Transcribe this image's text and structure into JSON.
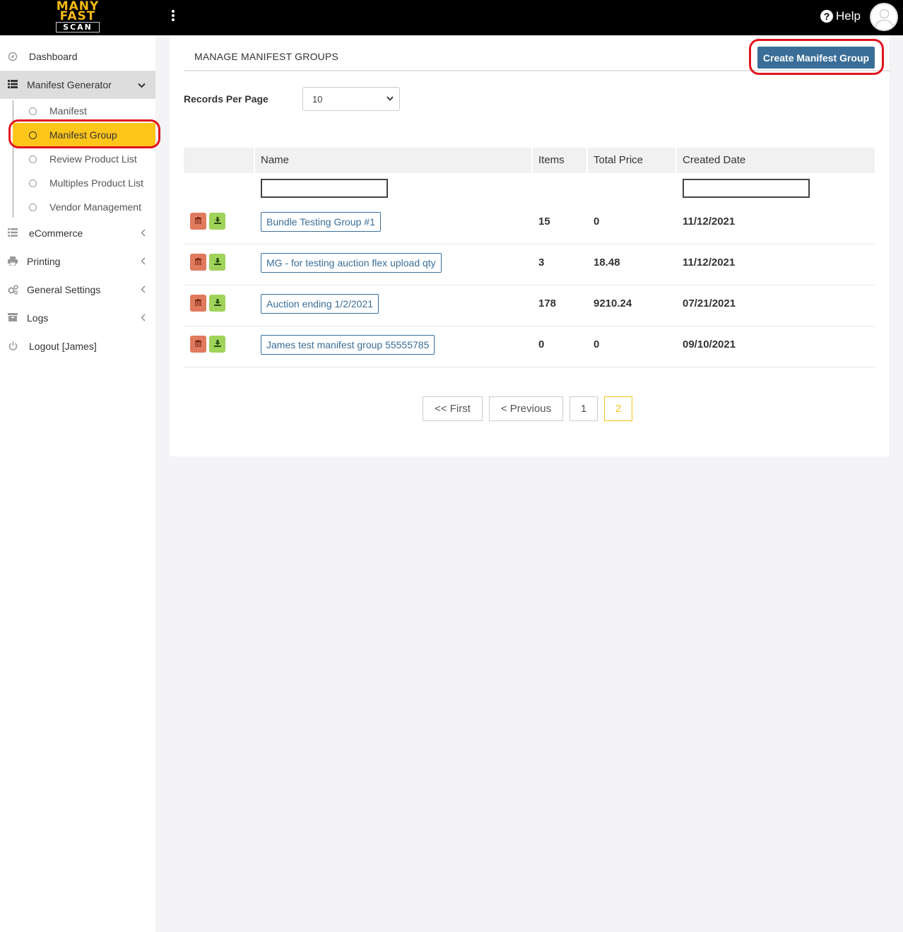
{
  "app": {
    "logo_line1": "MANY",
    "logo_line2": "FAST",
    "logo_line3": "SCAN"
  },
  "topbar": {
    "help_label": "Help",
    "help_icon": "question-circle-icon"
  },
  "sidebar": {
    "items": [
      {
        "label": "Dashboard",
        "icon": "compass-icon"
      },
      {
        "label": "Manifest Generator",
        "icon": "list-icon",
        "expanded": true
      },
      {
        "label": "eCommerce",
        "icon": "list-icon"
      },
      {
        "label": "Printing",
        "icon": "printer-icon"
      },
      {
        "label": "General Settings",
        "icon": "gears-icon"
      },
      {
        "label": "Logs",
        "icon": "archive-icon"
      },
      {
        "label": "Logout [James]",
        "icon": "power-icon"
      }
    ],
    "sub_items": [
      {
        "label": "Manifest"
      },
      {
        "label": "Manifest Group",
        "current": true
      },
      {
        "label": "Review Product List"
      },
      {
        "label": "Multiples Product List"
      },
      {
        "label": "Vendor Management"
      }
    ]
  },
  "main": {
    "title": "MANAGE MANIFEST GROUPS",
    "create_button": "Create Manifest Group",
    "records_per_page_label": "Records Per Page",
    "records_per_page_value": "10",
    "columns": [
      "Name",
      "Items",
      "Total Price",
      "Created Date"
    ],
    "rows": [
      {
        "name": "Bundle Testing Group #1",
        "items": "15",
        "total_price": "0",
        "created": "11/12/2021"
      },
      {
        "name": "MG - for testing auction flex upload qty",
        "items": "3",
        "total_price": "18.48",
        "created": "11/12/2021"
      },
      {
        "name": "Auction ending 1/2/2021",
        "items": "178",
        "total_price": "9210.24",
        "created": "07/21/2021"
      },
      {
        "name": "James test manifest group 55555785",
        "items": "0",
        "total_price": "0",
        "created": "09/10/2021"
      }
    ],
    "pagination": {
      "first": "<< First",
      "previous": "< Previous",
      "page1": "1",
      "page2": "2",
      "current_page": "2"
    }
  },
  "colors": {
    "accent": "#f5c518",
    "primary": "#3a6e98",
    "delete": "#e07a5f",
    "download": "#9fd35a",
    "highlight": "#e0141e"
  }
}
